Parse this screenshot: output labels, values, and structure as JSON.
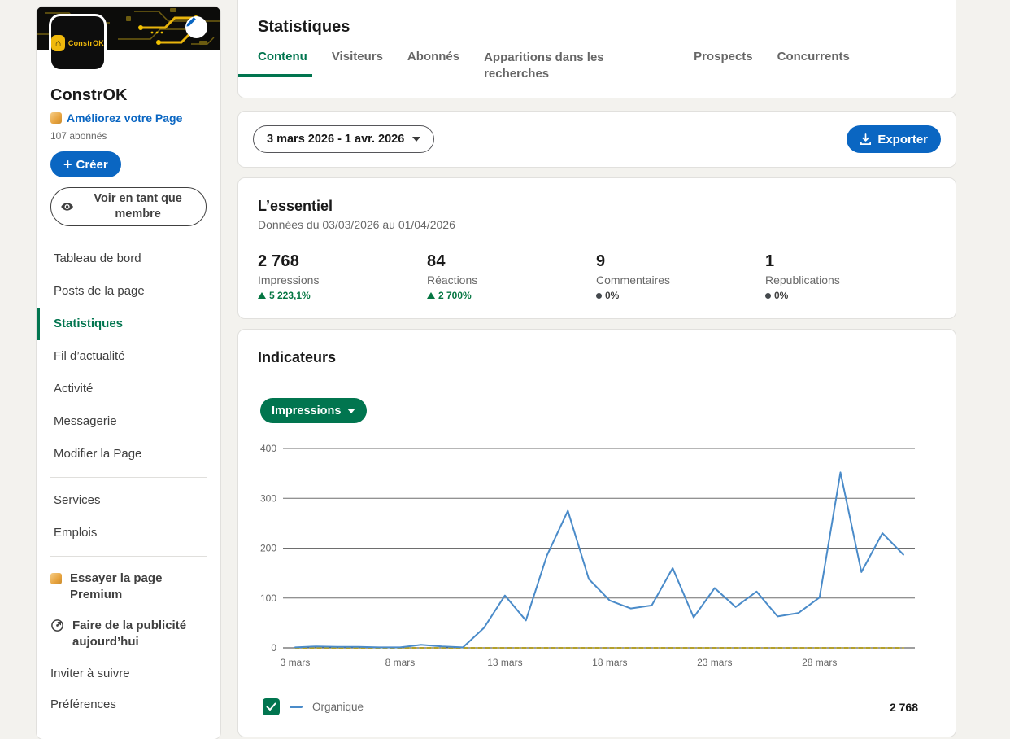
{
  "sidebar": {
    "company": "ConstrOK",
    "logo_text": "ConstrOK",
    "upsell_link": "Améliorez votre Page",
    "followers": "107 abonnés",
    "create_label": "Créer",
    "view_as_member": "Voir en tant que membre",
    "nav": [
      {
        "label": "Tableau de bord",
        "active": false
      },
      {
        "label": "Posts de la page",
        "active": false
      },
      {
        "label": "Statistiques",
        "active": true
      },
      {
        "label": "Fil d’actualité",
        "active": false
      },
      {
        "label": "Activité",
        "active": false
      },
      {
        "label": "Messagerie",
        "active": false
      },
      {
        "label": "Modifier la Page",
        "active": false
      }
    ],
    "nav2": [
      {
        "label": "Services"
      },
      {
        "label": "Emplois"
      }
    ],
    "footer_links": [
      {
        "label": "Essayer la page Premium",
        "icon": "premium-icon",
        "bold": true
      },
      {
        "label": "Faire de la publicité aujourd’hui",
        "icon": "ads-icon",
        "bold": true
      },
      {
        "label": "Inviter à suivre",
        "icon": null,
        "bold": false
      },
      {
        "label": "Préférences",
        "icon": null,
        "bold": false
      }
    ]
  },
  "header": {
    "title": "Statistiques",
    "tabs": [
      {
        "label": "Contenu",
        "active": true,
        "wrap": false
      },
      {
        "label": "Visiteurs",
        "active": false,
        "wrap": false
      },
      {
        "label": "Abonnés",
        "active": false,
        "wrap": false
      },
      {
        "label": "Apparitions dans les recherches",
        "active": false,
        "wrap": true
      },
      {
        "label": "Prospects",
        "active": false,
        "wrap": false
      },
      {
        "label": "Concurrents",
        "active": false,
        "wrap": false
      }
    ]
  },
  "toolbar": {
    "date_range": "3 mars 2026 - 1 avr. 2026",
    "export_label": "Exporter"
  },
  "essentials": {
    "title": "L’essentiel",
    "subtitle": "Données du 03/03/2026 au 01/04/2026",
    "stats": [
      {
        "value": "2 768",
        "label": "Impressions",
        "delta": "5 223,1%",
        "trend": "up"
      },
      {
        "value": "84",
        "label": "Réactions",
        "delta": "2 700%",
        "trend": "up"
      },
      {
        "value": "9",
        "label": "Commentaires",
        "delta": "0%",
        "trend": "flat"
      },
      {
        "value": "1",
        "label": "Republications",
        "delta": "0%",
        "trend": "flat"
      }
    ]
  },
  "indicators": {
    "title": "Indicateurs",
    "metric_selector": "Impressions",
    "legend": {
      "label": "Organique",
      "total": "2 768"
    }
  },
  "chart_data": {
    "type": "line",
    "categories": [
      "3 mars",
      "4 mars",
      "5 mars",
      "6 mars",
      "7 mars",
      "8 mars",
      "9 mars",
      "10 mars",
      "11 mars",
      "12 mars",
      "13 mars",
      "14 mars",
      "15 mars",
      "16 mars",
      "17 mars",
      "18 mars",
      "19 mars",
      "20 mars",
      "21 mars",
      "22 mars",
      "23 mars",
      "24 mars",
      "25 mars",
      "26 mars",
      "27 mars",
      "28 mars",
      "29 mars",
      "30 mars",
      "31 mars",
      "1 avr."
    ],
    "series": [
      {
        "name": "Organique",
        "color": "#4a8bc9",
        "style": "solid",
        "values": [
          1,
          3,
          2,
          2,
          1,
          1,
          6,
          3,
          1,
          40,
          105,
          55,
          185,
          275,
          138,
          95,
          79,
          85,
          160,
          61,
          120,
          82,
          113,
          63,
          70,
          101,
          352,
          152,
          230,
          187
        ]
      },
      {
        "name": "",
        "color": "#b3a02b",
        "style": "dashed",
        "values": [
          0,
          0,
          0,
          0,
          0,
          0,
          0,
          0,
          0,
          0,
          0,
          0,
          0,
          0,
          0,
          0,
          0,
          0,
          0,
          0,
          0,
          0,
          0,
          0,
          0,
          0,
          0,
          0,
          0,
          0
        ]
      }
    ],
    "ylim": [
      0,
      400
    ],
    "yticks": [
      0,
      100,
      200,
      300,
      400
    ],
    "xticks": [
      "3 mars",
      "8 mars",
      "13 mars",
      "18 mars",
      "23 mars",
      "28 mars"
    ],
    "grid": "horizontal",
    "legend_position": "bottom"
  }
}
